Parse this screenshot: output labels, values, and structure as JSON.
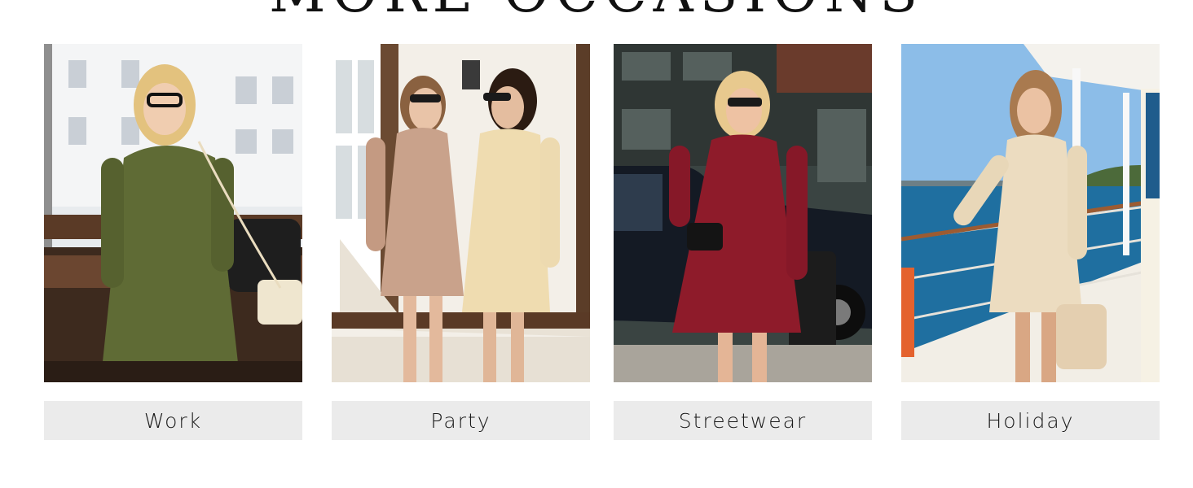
{
  "heading": "MORE OCCASIONS",
  "occasions": [
    {
      "label": "Work",
      "dress_color": "#5f6b35",
      "bg_color": "#e9ecef",
      "accent": "#3a2a20"
    },
    {
      "label": "Party",
      "dress_color": "#c9a28b",
      "bg_color": "#f1ece2",
      "accent": "#5a3d2b",
      "dress_color_2": "#efdcb0"
    },
    {
      "label": "Streetwear",
      "dress_color": "#8e1b2a",
      "bg_color": "#3f4a47",
      "accent": "#1b1f2a"
    },
    {
      "label": "Holiday",
      "dress_color": "#ecdcc0",
      "bg_color": "#7fb4e6",
      "accent": "#1f6fa0"
    }
  ]
}
